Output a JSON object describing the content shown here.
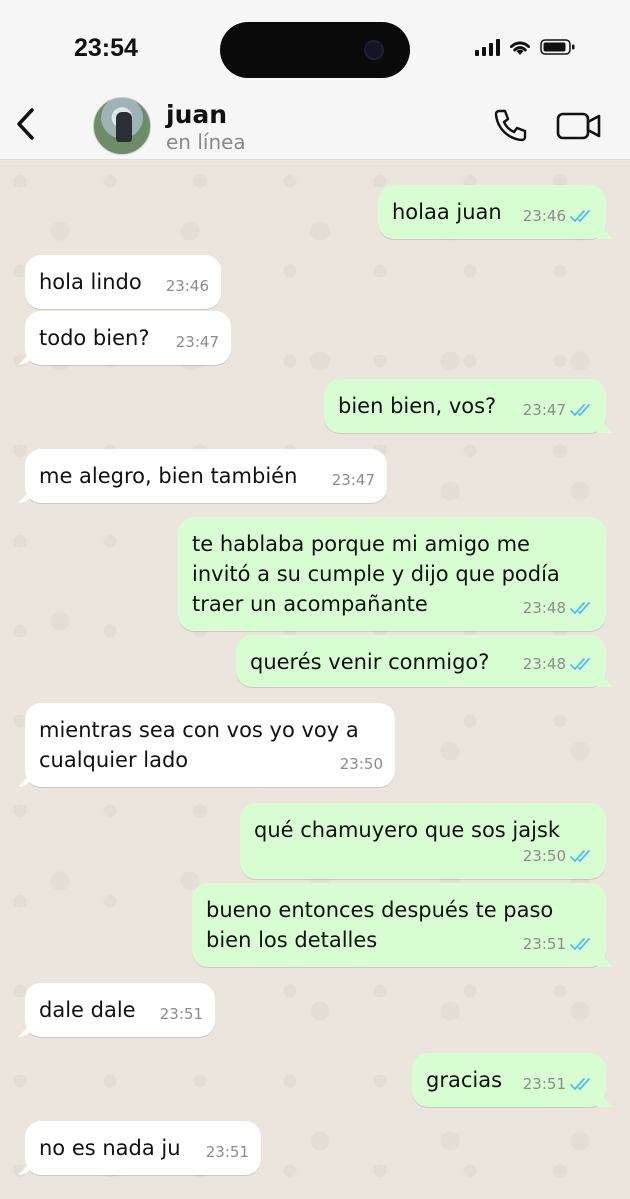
{
  "status_bar": {
    "time": "23:54"
  },
  "header": {
    "name": "juan",
    "status": "en línea"
  },
  "messages": [
    {
      "dir": "out",
      "text": "holaa juan",
      "time": "23:46"
    },
    {
      "dir": "in",
      "text": "hola lindo",
      "time": "23:46"
    },
    {
      "dir": "in",
      "text": "todo bien?",
      "time": "23:47"
    },
    {
      "dir": "out",
      "text": "bien bien, vos?",
      "time": "23:47"
    },
    {
      "dir": "in",
      "text": "me alegro, bien también",
      "time": "23:47"
    },
    {
      "dir": "out",
      "text": "te hablaba porque mi amigo me\ninvitó a su cumple y dijo que podía\ntraer un acompañante",
      "time": "23:48"
    },
    {
      "dir": "out",
      "text": "querés venir conmigo?",
      "time": "23:48"
    },
    {
      "dir": "in",
      "text": "mientras sea con vos yo voy a\ncualquier lado",
      "time": "23:50"
    },
    {
      "dir": "out",
      "text": "qué chamuyero que sos jajsk",
      "time": "23:50"
    },
    {
      "dir": "out",
      "text": "bueno entonces después te paso\nbien los detalles",
      "time": "23:51"
    },
    {
      "dir": "in",
      "text": "dale dale",
      "time": "23:51"
    },
    {
      "dir": "out",
      "text": "gracias",
      "time": "23:51"
    },
    {
      "dir": "in",
      "text": "no es nada ju",
      "time": "23:51"
    }
  ],
  "icons": {
    "back": "chevron-left-icon",
    "call": "phone-icon",
    "video": "video-camera-icon",
    "read": "double-check-icon"
  },
  "colors": {
    "outgoing_bubble": "#d9fdd3",
    "incoming_bubble": "#ffffff",
    "read_tick": "#53bdeb"
  }
}
